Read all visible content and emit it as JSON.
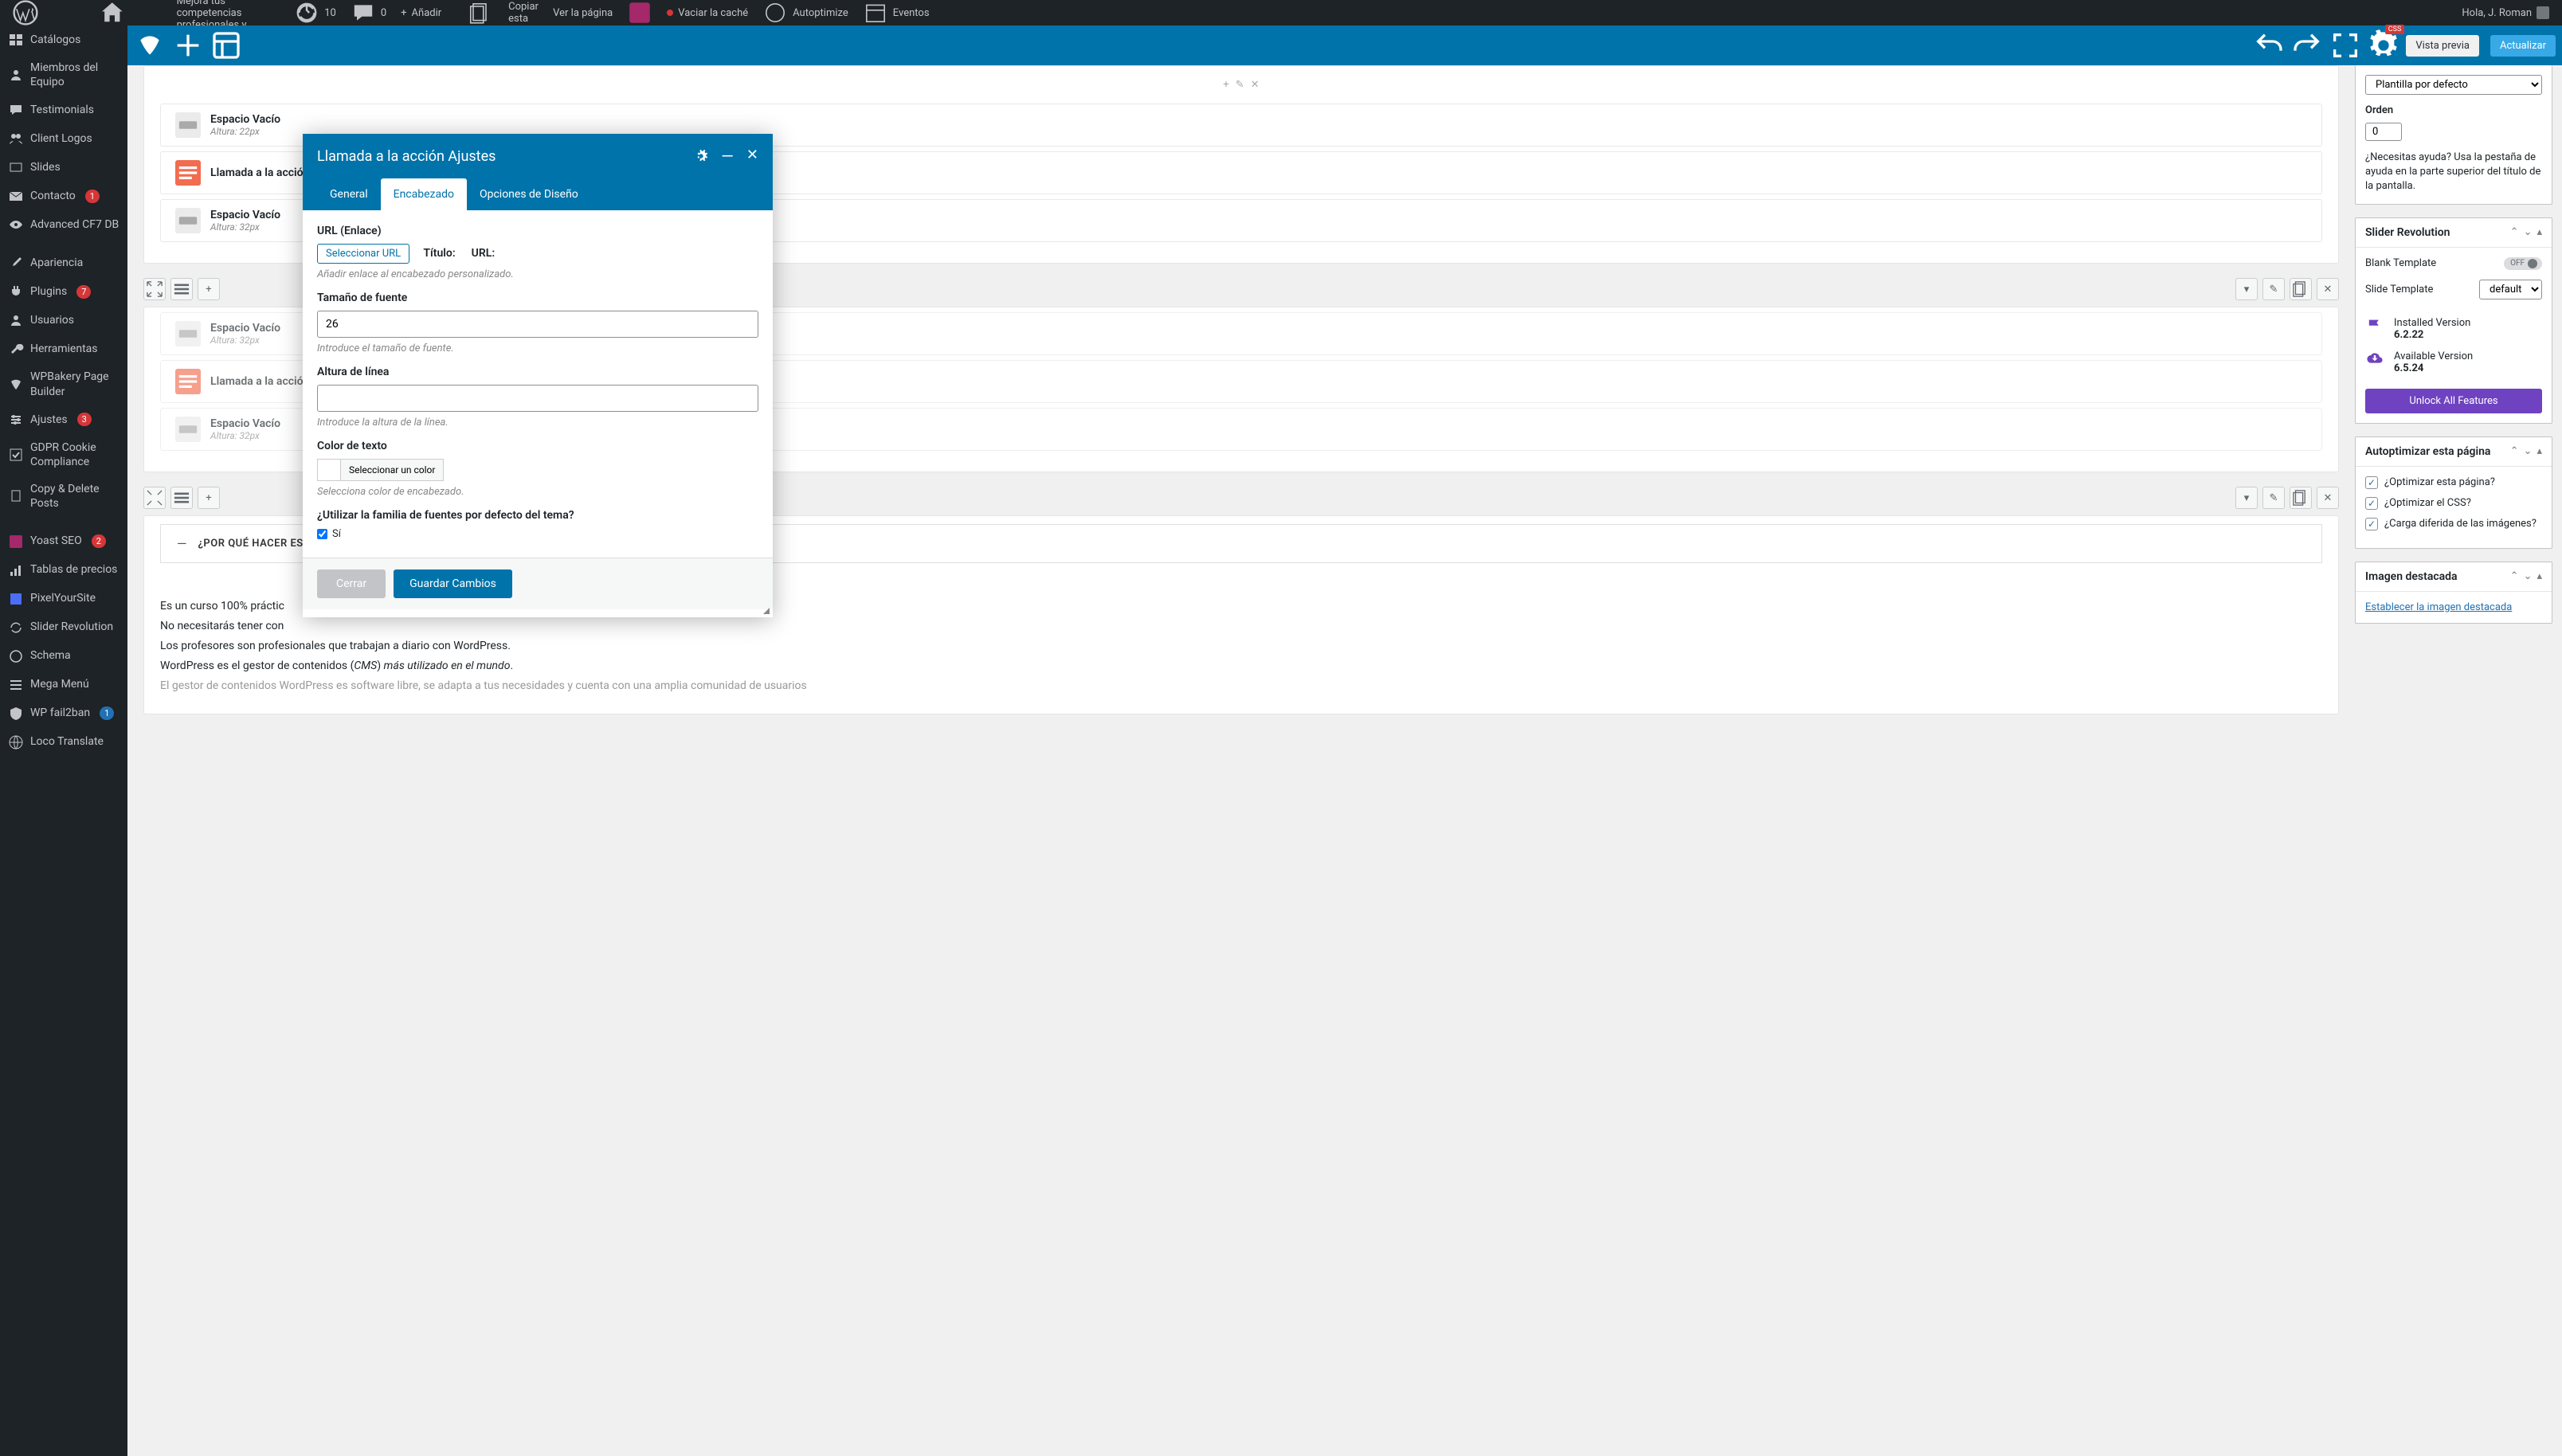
{
  "adminbar": {
    "site_title": "Mejora tus competencias profesionales y...",
    "refresh_count": "10",
    "comments_count": "0",
    "add": "Añadir",
    "copy": "Copiar esta",
    "view": "Ver la página",
    "cache": "Vaciar la caché",
    "autoptimize": "Autoptimize",
    "events": "Eventos",
    "greeting": "Hola, J. Roman"
  },
  "sidebar": {
    "items": [
      {
        "label": "Catálogos",
        "icon": "catalog"
      },
      {
        "label": "Miembros del Equipo",
        "icon": "user"
      },
      {
        "label": "Testimonials",
        "icon": "comment"
      },
      {
        "label": "Client Logos",
        "icon": "users"
      },
      {
        "label": "Slides",
        "icon": "slides"
      },
      {
        "label": "Contacto",
        "icon": "mail",
        "badge": "1"
      },
      {
        "label": "Advanced CF7 DB",
        "icon": "eye"
      },
      {
        "label": "Apariencia",
        "icon": "brush"
      },
      {
        "label": "Plugins",
        "icon": "plug",
        "badge": "7"
      },
      {
        "label": "Usuarios",
        "icon": "user"
      },
      {
        "label": "Herramientas",
        "icon": "wrench"
      },
      {
        "label": "WPBakery Page Builder",
        "icon": "wpb"
      },
      {
        "label": "Ajustes",
        "icon": "sliders",
        "badge": "3"
      },
      {
        "label": "GDPR Cookie Compliance",
        "icon": "check"
      },
      {
        "label": "Copy & Delete Posts",
        "icon": "copy"
      },
      {
        "label": "Yoast SEO",
        "icon": "yoast",
        "badge": "2"
      },
      {
        "label": "Tablas de precios",
        "icon": "chart"
      },
      {
        "label": "PixelYourSite",
        "icon": "pixel"
      },
      {
        "label": "Slider Revolution",
        "icon": "refresh"
      },
      {
        "label": "Schema",
        "icon": "circle"
      },
      {
        "label": "Mega Menú",
        "icon": "menu"
      },
      {
        "label": "WP fail2ban",
        "icon": "shield",
        "badge": "1",
        "badge_blue": true
      },
      {
        "label": "Loco Translate",
        "icon": "globe"
      }
    ]
  },
  "toolbar": {
    "preview": "Vista previa",
    "update": "Actualizar",
    "css_tag": "CSS"
  },
  "elements": {
    "espacio_vacio": "Espacio Vacío",
    "altura_22": "Altura: 22px",
    "altura_32": "Altura: 32px",
    "llamada_accion": "Llamada a la acción"
  },
  "modal": {
    "title": "Llamada a la acción Ajustes",
    "tabs": {
      "general": "General",
      "encabezado": "Encabezado",
      "diseno": "Opciones de Diseño"
    },
    "url_label": "URL (Enlace)",
    "url_btn": "Seleccionar URL",
    "titulo_label": "Título:",
    "url2_label": "URL:",
    "url_help": "Añadir enlace al encabezado personalizado.",
    "fontsize_label": "Tamaño de fuente",
    "fontsize_value": "26",
    "fontsize_help": "Introduce el tamaño de fuente.",
    "lineheight_label": "Altura de línea",
    "lineheight_help": "Introduce la altura de la línea.",
    "color_label": "Color de texto",
    "color_btn": "Seleccionar un color",
    "color_help": "Selecciona color de encabezado.",
    "fontfamily_label": "¿Utilizar la familia de fuentes por defecto del tema?",
    "yes": "Sí",
    "close": "Cerrar",
    "save": "Guardar Cambios"
  },
  "accordion": {
    "title": "¿POR QUÉ HACER EST"
  },
  "body_paragraphs": [
    "Es un curso 100% práctic",
    "No necesitarás tener con",
    "Los profesores son profesionales que trabajan a diario con WordPress.",
    "WordPress es el gestor de contenidos (CMS) más utilizado en el mundo."
  ],
  "body_partial": "El gestor de contenidos WordPress es software libre, se adapta a tus necesidades y cuenta con una amplia comunidad de usuarios",
  "right_panel": {
    "template_select": "Plantilla por defecto",
    "orden_label": "Orden",
    "orden_value": "0",
    "help_text": "¿Necesitas ayuda? Usa la pestaña de ayuda en la parte superior del título de la pantalla.",
    "slider_rev": {
      "title": "Slider Revolution",
      "blank": "Blank Template",
      "off": "OFF",
      "slide_template": "Slide Template",
      "default": "default",
      "installed_label": "Installed Version",
      "installed_ver": "6.2.22",
      "available_label": "Available Version",
      "available_ver": "6.5.24",
      "unlock": "Unlock All Features"
    },
    "autoptimize": {
      "title": "Autoptimizar esta página",
      "opt1": "¿Optimizar esta página?",
      "opt2": "¿Optimizar el CSS?",
      "opt3": "¿Carga diferida de las imágenes?"
    },
    "featured": {
      "title": "Imagen destacada",
      "link": "Establecer la imagen destacada"
    }
  }
}
